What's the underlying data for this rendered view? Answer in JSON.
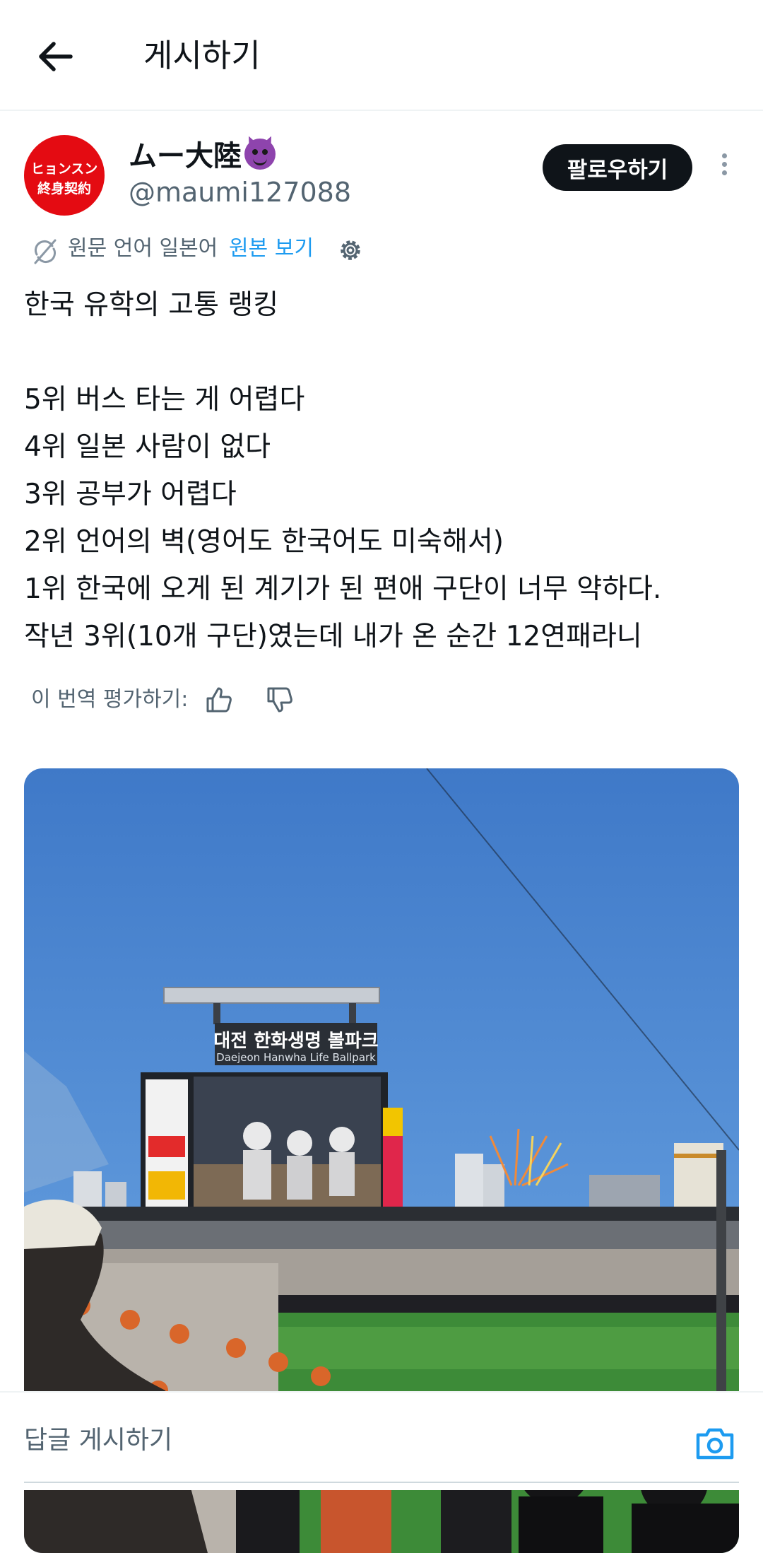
{
  "header": {
    "title": "게시하기"
  },
  "author": {
    "avatar_line1": "ヒョンスン",
    "avatar_line2": "終身契約",
    "display_name": "ムー大陸",
    "handle": "@maumi127088",
    "follow_label": "팔로우하기"
  },
  "translation": {
    "source_label": "원문 언어 일본어",
    "show_original": "원본 보기"
  },
  "tweet": {
    "text": "한국 유학의 고통 랭킹\n\n5위 버스 타는 게 어렵다\n4위 일본 사람이 없다\n3위 공부가 어렵다\n2위 언어의 벽(영어도 한국어도 미숙해서)\n1위 한국에 오게 된 계기가 된 편애 구단이 너무 약하다.\n작년 3위(10개 구단)였는데 내가 온 순간 12연패라니"
  },
  "rating": {
    "label": "이 번역 평가하기:"
  },
  "media": {
    "scoreboard_title": "대전 한화생명 볼파크",
    "scoreboard_subtitle": "Daejeon Hanwha Life Ballpark"
  },
  "reply": {
    "placeholder": "답글 게시하기"
  },
  "colors": {
    "accent": "#1d9bf0",
    "avatar_bg": "#e40b12",
    "follow_bg": "#0f1419"
  }
}
